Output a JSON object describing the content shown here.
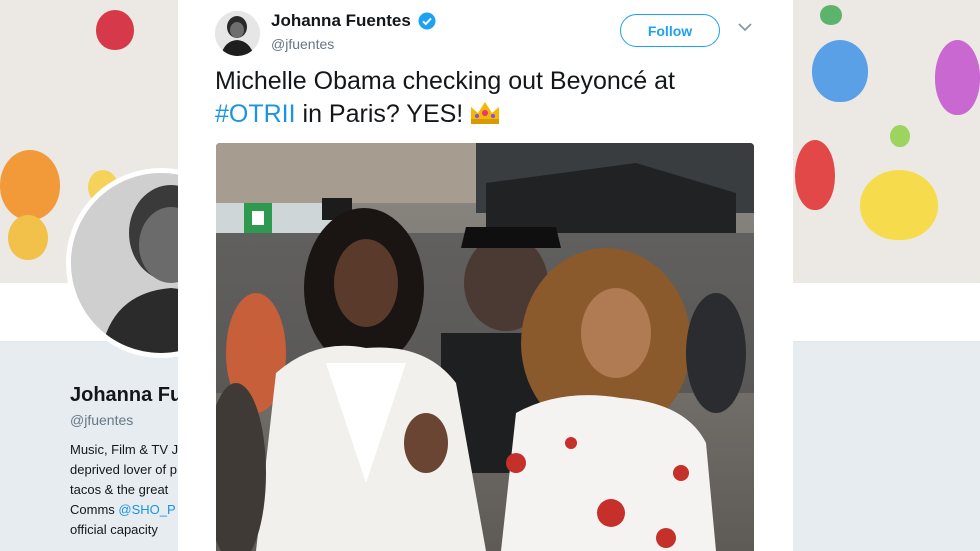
{
  "profile": {
    "name": "Johanna Fu",
    "handle": "@jfuentes",
    "bio_lines": [
      "Music, Film & TV J",
      "deprived lover of p",
      "tacos & the great",
      "official capacity"
    ],
    "bio_comms_prefix": "Comms ",
    "bio_comms_link": "@SHO_P"
  },
  "tweet": {
    "author_name": "Johanna Fuentes",
    "author_handle": "@jfuentes",
    "follow_label": "Follow",
    "text_part1": "Michelle Obama checking out Beyoncé at",
    "hashtag": "#OTRII",
    "text_part2": " in Paris? YES!",
    "emoji_name": "crown-icon"
  },
  "colors": {
    "accent": "#1da1f2",
    "link": "#1b95e0",
    "text": "#14171a",
    "muted": "#657786"
  }
}
